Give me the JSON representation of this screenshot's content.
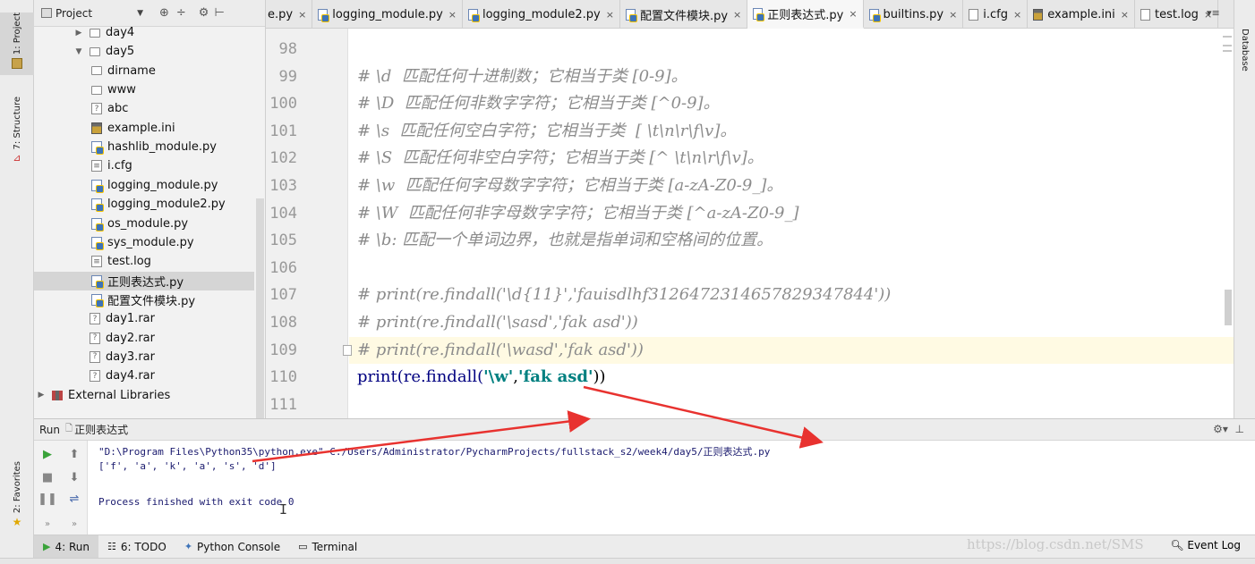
{
  "left_stripe": {
    "project_tab": "1: Project",
    "structure_tab": "7: Structure",
    "favorites_tab": "2: Favorites"
  },
  "right_stripe": {
    "database_tab": "Database"
  },
  "project_panel": {
    "title": "Project"
  },
  "tree": [
    {
      "label": "day4",
      "type": "folder",
      "depth": 2,
      "state": "collapsed"
    },
    {
      "label": "day5",
      "type": "folder",
      "depth": 2,
      "state": "expanded"
    },
    {
      "label": "dirname",
      "type": "folder",
      "depth": 3
    },
    {
      "label": "www",
      "type": "folder",
      "depth": 3
    },
    {
      "label": "abc",
      "type": "unknown",
      "depth": 3
    },
    {
      "label": "example.ini",
      "type": "ini",
      "depth": 3
    },
    {
      "label": "hashlib_module.py",
      "type": "py",
      "depth": 3
    },
    {
      "label": "i.cfg",
      "type": "text",
      "depth": 3
    },
    {
      "label": "logging_module.py",
      "type": "py",
      "depth": 3
    },
    {
      "label": "logging_module2.py",
      "type": "py",
      "depth": 3
    },
    {
      "label": "os_module.py",
      "type": "py",
      "depth": 3
    },
    {
      "label": "sys_module.py",
      "type": "py",
      "depth": 3
    },
    {
      "label": "test.log",
      "type": "text",
      "depth": 3
    },
    {
      "label": "正则表达式.py",
      "type": "py",
      "depth": 3,
      "selected": true
    },
    {
      "label": "配置文件模块.py",
      "type": "py",
      "depth": 3
    },
    {
      "label": "day1.rar",
      "type": "unknown",
      "depth": 2
    },
    {
      "label": "day2.rar",
      "type": "unknown",
      "depth": 2
    },
    {
      "label": "day3.rar",
      "type": "unknown",
      "depth": 2
    },
    {
      "label": "day4.rar",
      "type": "unknown",
      "depth": 2
    },
    {
      "label": "External Libraries",
      "type": "lib",
      "depth": 0,
      "state": "collapsed"
    }
  ],
  "tabs": [
    {
      "label": "e.py",
      "type": "py"
    },
    {
      "label": "logging_module.py",
      "type": "py"
    },
    {
      "label": "logging_module2.py",
      "type": "py"
    },
    {
      "label": "配置文件模块.py",
      "type": "py"
    },
    {
      "label": "正则表达式.py",
      "type": "py",
      "active": true
    },
    {
      "label": "builtins.py",
      "type": "py"
    },
    {
      "label": "i.cfg",
      "type": "text"
    },
    {
      "label": "example.ini",
      "type": "ini"
    },
    {
      "label": "test.log",
      "type": "text"
    }
  ],
  "tab_overflow": "▾≡",
  "editor": {
    "line_numbers": [
      "98",
      "99",
      "100",
      "101",
      "102",
      "103",
      "104",
      "105",
      "106",
      "107",
      "108",
      "109",
      "110",
      "111"
    ],
    "lines": [
      "",
      "# \\d  匹配任何十进制数；它相当于类 [0-9]。",
      "# \\D  匹配任何非数字字符；它相当于类 [^0-9]。",
      "# \\s  匹配任何空白字符；它相当于类  [ \\t\\n\\r\\f\\v]。",
      "# \\S  匹配任何非空白字符；它相当于类 [^ \\t\\n\\r\\f\\v]。",
      "# \\w  匹配任何字母数字字符；它相当于类 [a-zA-Z0-9_]。",
      "# \\W  匹配任何非字母数字字符；它相当于类 [^a-zA-Z0-9_]",
      "# \\b: 匹配一个单词边界，也就是指单词和空格间的位置。",
      "",
      "# print(re.findall('\\d{11}','fauisdlhf31264723146578293478 44'))",
      "# print(re.findall('\\sasd','fak asd'))",
      "# print(re.findall('\\wasd','fak asd'))",
      "",
      ""
    ],
    "line_107": "# print(re.findall('\\d{11}','fauisdlhf312647231465782934 7844'))",
    "line_107_text": "# print(re.findall('\\d{11}','fauisdlhf3126472314657829347844'))",
    "line_110": {
      "func": "print(re.findall(",
      "arg1": "'\\w'",
      "comma": ",",
      "arg2": "'fak asd'",
      "close": "))"
    }
  },
  "run_panel": {
    "header": "Run",
    "config_name": "正则表达式",
    "console": [
      "\"D:\\Program Files\\Python35\\python.exe\" C:/Users/Administrator/PycharmProjects/fullstack_s2/week4/day5/正则表达式.py",
      "['f', 'a', 'k', 'a', 's', 'd']",
      "",
      "Process finished with exit code 0"
    ]
  },
  "bottom_bar": {
    "run": "4: Run",
    "todo": "6: TODO",
    "python_console": "Python Console",
    "terminal": "Terminal",
    "event_log": "Event Log"
  },
  "watermark": "https://blog.csdn.net/SMS",
  "colors": {
    "annotation_arrow": "#e8322f",
    "comment": "#8c8c8c",
    "string": "#008080",
    "keyword": "#000080"
  }
}
